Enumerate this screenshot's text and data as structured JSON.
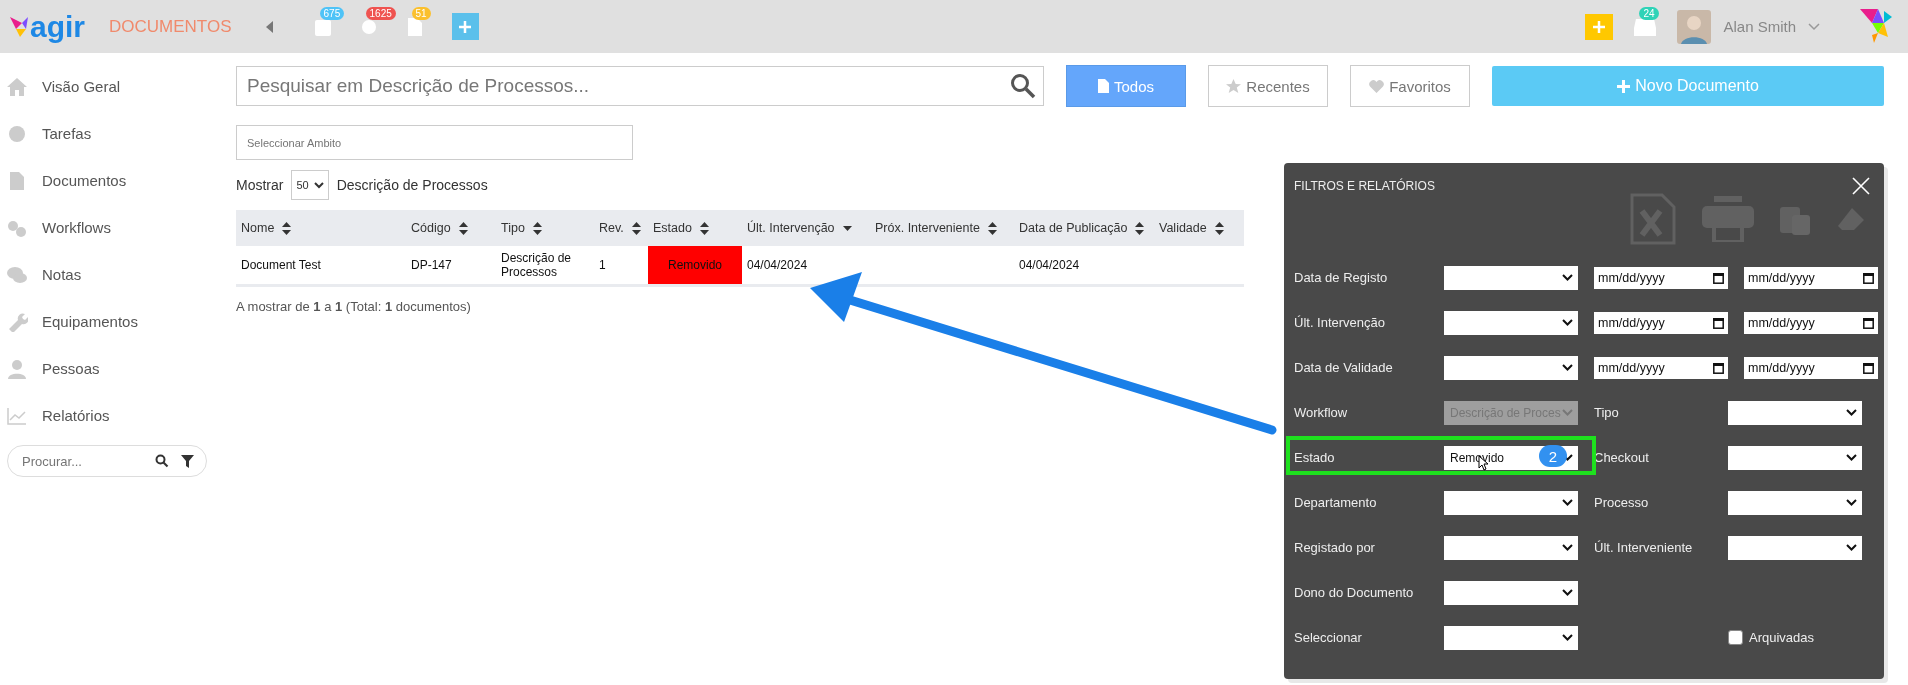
{
  "header": {
    "logo": "agir",
    "module": "DOCUMENTOS",
    "badges": [
      {
        "count": "675",
        "color": "#4fc3f7"
      },
      {
        "count": "1625",
        "color": "#ef5350"
      },
      {
        "count": "51",
        "color": "#fbc02d"
      }
    ],
    "inbox_count": "24",
    "user": "Alan Smith"
  },
  "sidebar": {
    "items": [
      {
        "label": "Visão Geral"
      },
      {
        "label": "Tarefas"
      },
      {
        "label": "Documentos"
      },
      {
        "label": "Workflows"
      },
      {
        "label": "Notas"
      },
      {
        "label": "Equipamentos"
      },
      {
        "label": "Pessoas"
      },
      {
        "label": "Relatórios"
      }
    ],
    "search": {
      "placeholder": "Procurar..."
    }
  },
  "search": {
    "placeholder": "Pesquisar em Descrição de Processos..."
  },
  "view_buttons": [
    {
      "label": "Todos",
      "selected": true
    },
    {
      "label": "Recentes",
      "selected": false
    },
    {
      "label": "Favoritos",
      "selected": false
    }
  ],
  "new_button": "Novo Documento",
  "scope": {
    "placeholder": "Seleccionar Ambito"
  },
  "page_size": {
    "label": "Mostrar",
    "value": "50",
    "caption": "Descrição de Processos"
  },
  "table": {
    "columns": [
      {
        "label": "Nome",
        "sorted": false
      },
      {
        "label": "Código",
        "sorted": false
      },
      {
        "label": "Tipo",
        "sorted": false
      },
      {
        "label": "Rev.",
        "sorted": false
      },
      {
        "label": "Estado",
        "sorted": false
      },
      {
        "label": "Últ. Intervenção",
        "sorted": true
      },
      {
        "label": "Próx. Interveniente",
        "sorted": false
      },
      {
        "label": "Data de Publicação",
        "sorted": false
      },
      {
        "label": "Validade",
        "sorted": false
      }
    ],
    "rows": [
      {
        "cells": [
          {
            "text": "Document Test"
          },
          {
            "text": "DP-147"
          },
          {
            "text": "Descrição de Processos"
          },
          {
            "text": "1"
          },
          {
            "text": "Removido",
            "color": "#ff0000"
          },
          {
            "text": "04/04/2024"
          },
          {},
          {
            "text": "04/04/2024"
          },
          {}
        ]
      }
    ]
  },
  "summary": "A mostrar de **1** a **1** (Total: **1** documentos)",
  "filter_panel": {
    "title": "FILTROS E RELATÓRIOS",
    "rows": [
      {
        "kind": "date",
        "label": "Data de Registo",
        "from": "mm/dd/yyyy",
        "to": "mm/dd/yyyy"
      },
      {
        "kind": "date",
        "label": "Últ. Intervenção",
        "from": "mm/dd/yyyy",
        "to": "mm/dd/yyyy"
      },
      {
        "kind": "date",
        "label": "Data de Validade",
        "from": "mm/dd/yyyy",
        "to": "mm/dd/yyyy"
      },
      {
        "kind": "pair",
        "label": "Workflow",
        "value": "Descrição de Proces",
        "disabled": true,
        "label2": "Tipo"
      },
      {
        "kind": "pair",
        "label": "Estado",
        "value": "Removido",
        "highlighted": true,
        "step": "2",
        "label2": "Checkout"
      },
      {
        "kind": "pair",
        "label": "Departamento",
        "label2": "Processo"
      },
      {
        "kind": "pair",
        "label": "Registado por",
        "label2": "Últ. Interveniente"
      },
      {
        "kind": "single",
        "label": "Dono do Documento"
      },
      {
        "kind": "checkbox",
        "label": "Seleccionar",
        "check_label": "Arquivadas",
        "checked": false
      }
    ]
  }
}
